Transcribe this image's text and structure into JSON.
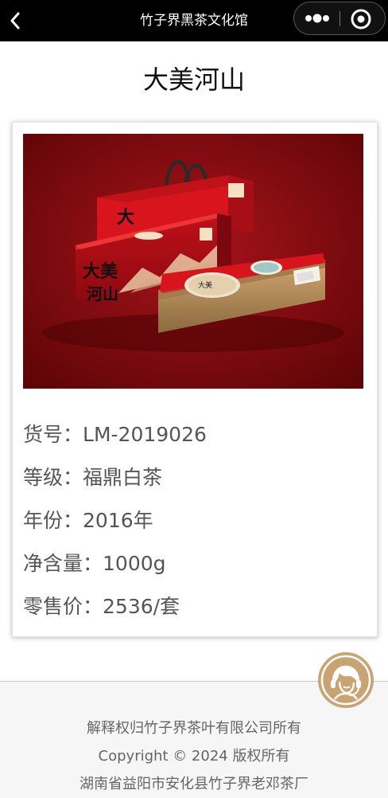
{
  "topbar": {
    "title": "竹子界黑茶文化馆",
    "back_icon": "chevron-left-icon",
    "more_icon": "more-dots-icon",
    "close_icon": "target-circle-icon"
  },
  "page": {
    "title": "大美河山"
  },
  "product": {
    "image_icon": "tea-gift-box-image",
    "image_box_text": "大美河山",
    "details": [
      {
        "label": "货号：",
        "value": "LM-2019026"
      },
      {
        "label": "等级：",
        "value": "福鼎白茶"
      },
      {
        "label": "年份：",
        "value": "2016年"
      },
      {
        "label": "净含量：",
        "value": "1000g"
      },
      {
        "label": "零售价：",
        "value": "2536/套"
      }
    ]
  },
  "footer": {
    "line1": "解释权归竹子界茶叶有限公司所有",
    "line2": "Copyright © 2024 版权所有",
    "line3": "湖南省益阳市安化县竹子界老邓茶厂"
  },
  "customer_service": {
    "icon": "customer-service-headset-icon"
  },
  "colors": {
    "topbar_bg": "#000000",
    "image_bg": "#8b0a0a",
    "box_red": "#d8141c",
    "badge_gold": "#c8a472"
  }
}
